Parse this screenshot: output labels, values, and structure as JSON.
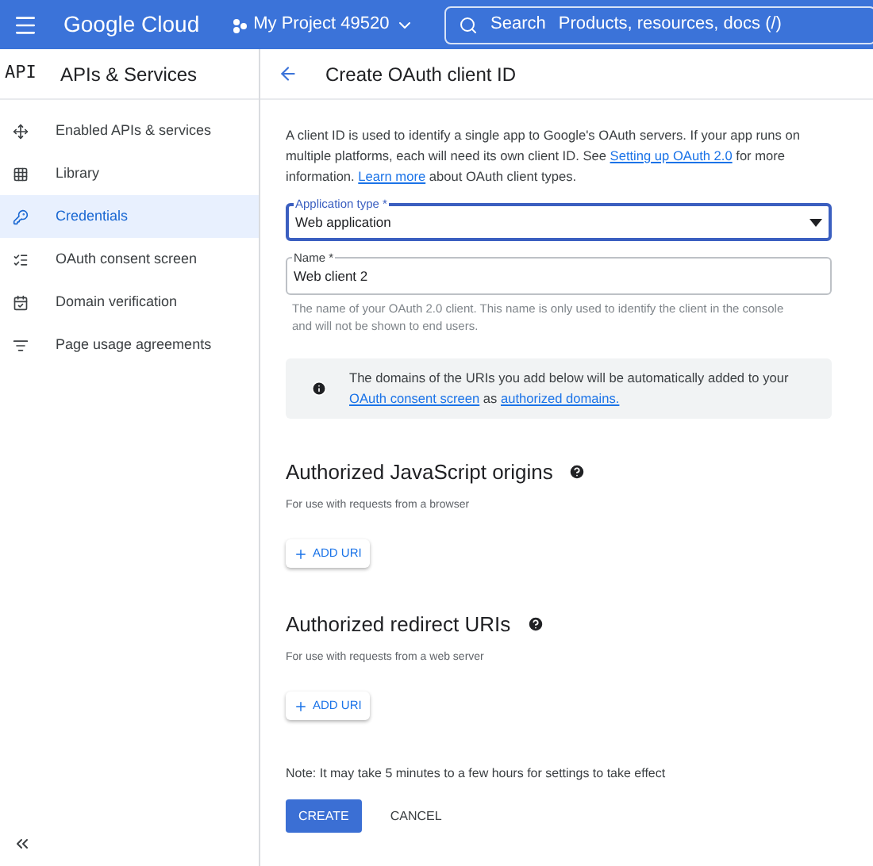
{
  "header": {
    "logo": "Google Cloud",
    "project": "My Project 49520",
    "search_label": "Search",
    "search_placeholder": "Products, resources, docs (/)"
  },
  "sidebar": {
    "badge": "API",
    "title": "APIs & Services",
    "items": [
      {
        "label": "Enabled APIs & services",
        "selected": false
      },
      {
        "label": "Library",
        "selected": false
      },
      {
        "label": "Credentials",
        "selected": true
      },
      {
        "label": "OAuth consent screen",
        "selected": false
      },
      {
        "label": "Domain verification",
        "selected": false
      },
      {
        "label": "Page usage agreements",
        "selected": false
      }
    ]
  },
  "page": {
    "title": "Create OAuth client ID",
    "intro": [
      {
        "kind": "text",
        "text": "A client ID is used to identify a single app to Google's OAuth servers. If your app runs on multiple platforms, each will need its own client ID. See "
      },
      {
        "kind": "link",
        "text": "Setting up OAuth 2.0"
      },
      {
        "kind": "text",
        "text": " for more information. "
      },
      {
        "kind": "link",
        "text": "Learn more"
      },
      {
        "kind": "text",
        "text": " about OAuth client types."
      }
    ],
    "application_type": {
      "label": "Application type *",
      "value": "Web application"
    },
    "name_field": {
      "label": "Name *",
      "value": "Web client 2",
      "hint": "The name of your OAuth 2.0 client. This name is only used to identify the client in the console and will not be shown to end users."
    },
    "notice": [
      {
        "kind": "text",
        "text": "The domains of the URIs you add below will be automatically added to your "
      },
      {
        "kind": "link",
        "text": "OAuth consent screen"
      },
      {
        "kind": "text",
        "text": " as "
      },
      {
        "kind": "link",
        "text": "authorized domains."
      }
    ],
    "sections": [
      {
        "title": "Authorized JavaScript origins",
        "subtitle": "For use with requests from a browser",
        "button": "ADD URI"
      },
      {
        "title": "Authorized redirect URIs",
        "subtitle": "For use with requests from a web server",
        "button": "ADD URI"
      }
    ],
    "note": "Note: It may take 5 minutes to a few hours for settings to take effect",
    "buttons": {
      "create": "CREATE",
      "cancel": "CANCEL"
    }
  }
}
